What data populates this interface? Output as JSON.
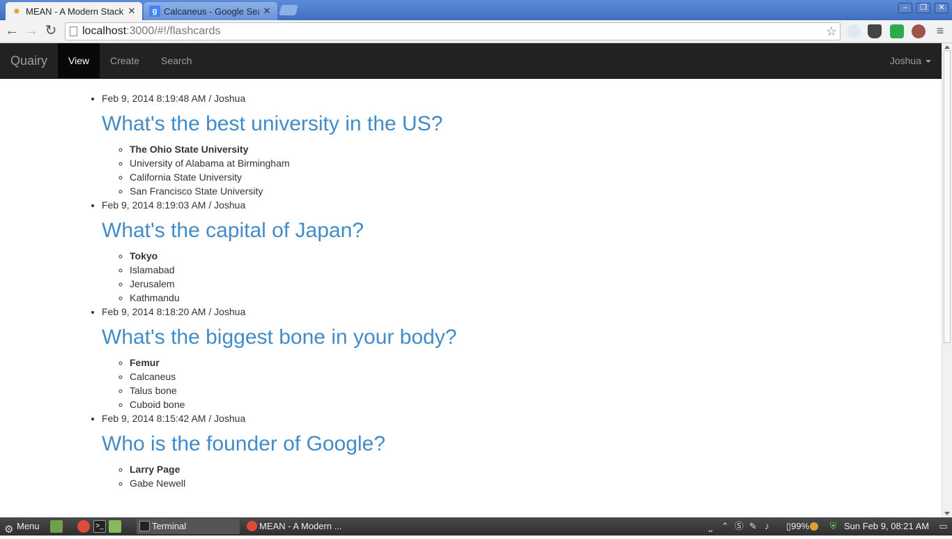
{
  "browser": {
    "tabs": [
      {
        "title": "MEAN - A Modern Stack",
        "favicon": "mean-logo-icon",
        "active": true
      },
      {
        "title": "Calcaneus - Google Sea",
        "favicon": "google-icon",
        "active": false
      }
    ],
    "url_host": "localhost",
    "url_rest": ":3000/#!/flashcards"
  },
  "navbar": {
    "brand": "Quairy",
    "links": [
      "View",
      "Create",
      "Search"
    ],
    "active_link": "View",
    "user": "Joshua"
  },
  "cards": [
    {
      "meta": "Feb 9, 2014 8:19:48 AM / Joshua",
      "question": "What's the best university in the US?",
      "answers": [
        "The Ohio State University",
        "University of Alabama at Birmingham",
        "California State University",
        "San Francisco State University"
      ]
    },
    {
      "meta": "Feb 9, 2014 8:19:03 AM / Joshua",
      "question": "What's the capital of Japan?",
      "answers": [
        "Tokyo",
        "Islamabad",
        "Jerusalem",
        "Kathmandu"
      ]
    },
    {
      "meta": "Feb 9, 2014 8:18:20 AM / Joshua",
      "question": "What's the biggest bone in your body?",
      "answers": [
        "Femur",
        "Calcaneus",
        "Talus bone",
        "Cuboid bone"
      ]
    },
    {
      "meta": "Feb 9, 2014 8:15:42 AM / Joshua",
      "question": "Who is the founder of Google?",
      "answers": [
        "Larry Page",
        "Gabe Newell"
      ]
    }
  ],
  "taskbar": {
    "menu_label": "Menu",
    "windows": [
      "Terminal",
      "MEAN - A Modern ..."
    ],
    "battery": "99%",
    "clock": "Sun Feb  9, 08:21 AM"
  },
  "colors": {
    "link_blue": "#428bca",
    "navbar_bg": "#222222",
    "chrome_blue": "#4a78c5"
  }
}
